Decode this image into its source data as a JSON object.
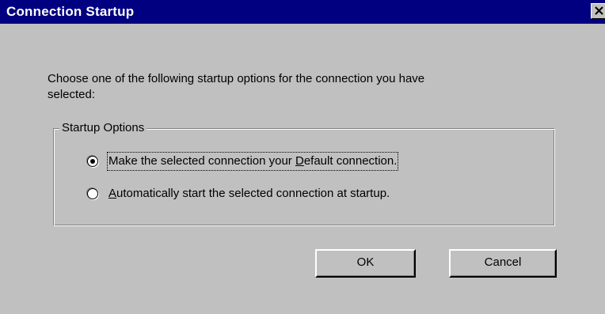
{
  "window": {
    "title": "Connection Startup"
  },
  "prompt": {
    "line1": "Choose one of the following startup options for the connection you have",
    "line2": "selected:"
  },
  "group": {
    "label": "Startup Options",
    "options": [
      {
        "pre": "Make the selected connection your ",
        "mnemonic": "D",
        "post": "efault connection.",
        "selected": true
      },
      {
        "pre": "",
        "mnemonic": "A",
        "post": "utomatically start the selected connection at startup.",
        "selected": false
      }
    ]
  },
  "buttons": {
    "ok": "OK",
    "cancel": "Cancel"
  },
  "icons": {
    "close": "close-icon"
  }
}
